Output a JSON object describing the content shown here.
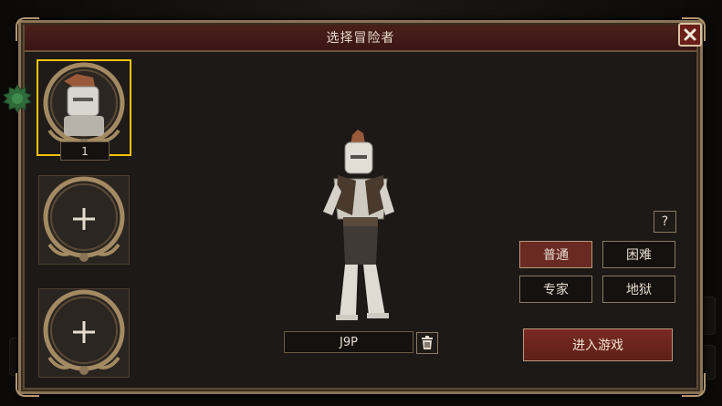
{
  "dialog": {
    "title": "选择冒险者"
  },
  "slots": [
    {
      "label": "1",
      "state": "selected"
    },
    {
      "state": "empty",
      "icon": "plus-icon"
    },
    {
      "state": "empty",
      "icon": "plus-icon"
    }
  ],
  "character": {
    "name": "J9P"
  },
  "help": {
    "label": "?"
  },
  "difficulty": {
    "options": [
      "普通",
      "困难",
      "专家",
      "地狱"
    ],
    "selected": "普通"
  },
  "actions": {
    "enter_label": "进入游戏"
  },
  "colors": {
    "selected_highlight": "#f2c20a",
    "title_bar": "#4a1f1c",
    "active_button": "#6a2a24",
    "gear": "#2f6b3a"
  }
}
